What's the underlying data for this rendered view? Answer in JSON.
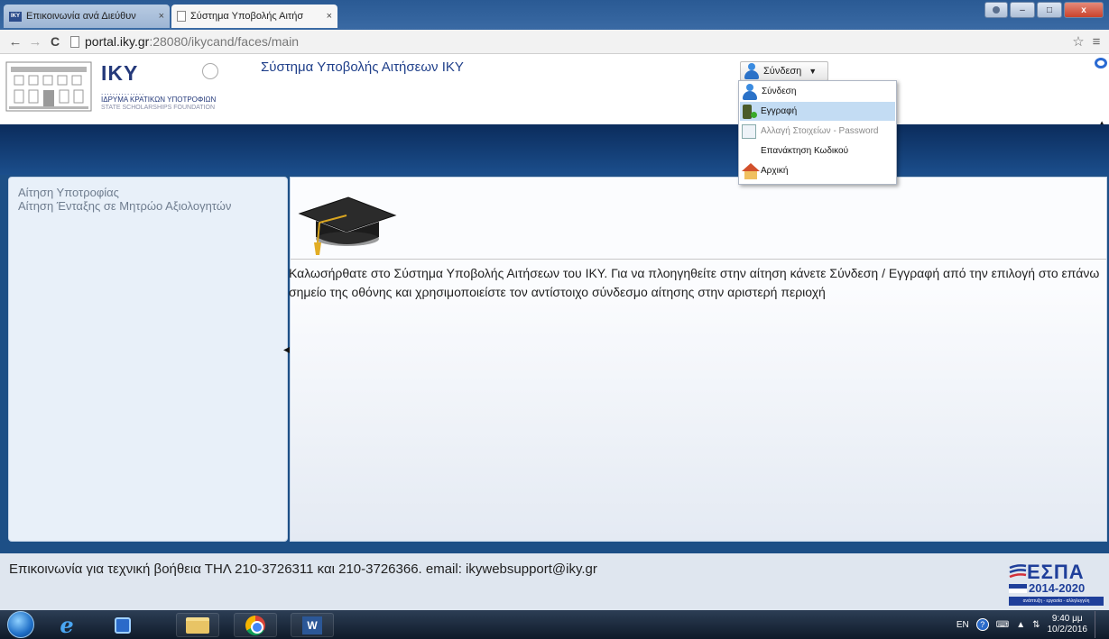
{
  "browser": {
    "tabs": [
      {
        "label": "Επικοινωνία ανά Διεύθυν",
        "favicon": "IKY",
        "close": "×",
        "active": false
      },
      {
        "label": "Σύστημα Υποβολής Αιτήσ",
        "close": "×",
        "active": true
      }
    ],
    "address": {
      "host": "portal.iky.gr",
      "rest": ":28080/ikycand/faces/main"
    },
    "window_controls": {
      "minimize": "–",
      "maximize": "□",
      "close": "x"
    }
  },
  "header": {
    "logo": {
      "abbrev": "IKY",
      "dots": "...............",
      "name_gr": "ΙΔΡΥΜΑ ΚΡΑΤΙΚΩΝ ΥΠΟΤΡΟΦΙΩΝ",
      "name_en": "STATE SCHOLARSHIPS FOUNDATION"
    },
    "title": "Σύστημα Υποβολής Αιτήσεων ΙΚΥ",
    "login_button": "Σύνδεση"
  },
  "login_menu": {
    "items": [
      {
        "label": "Σύνδεση",
        "icon": "user-icon",
        "state": "normal"
      },
      {
        "label": "Εγγραφή",
        "icon": "register-icon",
        "state": "highlighted"
      },
      {
        "label": "Αλλαγή Στοιχείων - Password",
        "icon": "edit-icon",
        "state": "disabled"
      },
      {
        "label": "Επανάκτηση Κωδικού",
        "icon": "",
        "state": "normal"
      },
      {
        "label": "Αρχική",
        "icon": "home-icon",
        "state": "normal"
      }
    ]
  },
  "sidebar": {
    "links": [
      "Αίτηση Υποτροφίας",
      "Αίτηση Ένταξης σε Μητρώο Αξιολογητών"
    ]
  },
  "content": {
    "welcome": "Καλωσήρθατε στο Σύστημα Υποβολής Αιτήσεων του ΙΚΥ. Για να πλοηγηθείτε στην αίτηση κάνετε Σύνδεση / Εγγραφή από την επιλογή στο επάνω σημείο της οθόνης και χρησιμοποιείστε τον αντίστοιχο σύνδεσμο αίτησης στην αριστερή περιοχή"
  },
  "footer": {
    "support_text": "Επικοινωνία για τεχνική βοήθεια ΤΗΛ 210-3726311 και 210-3726366. email: ikywebsupport@iky.gr",
    "espa": {
      "word": "ΕΣΠΑ",
      "years": "2014-2020",
      "slogan": "ανάπτυξη - εργασία - αλληλεγγύη"
    }
  },
  "taskbar": {
    "language": "EN",
    "time": "9:40 μμ",
    "date": "10/2/2016"
  },
  "colors": {
    "portal_blue": "#1d4f86",
    "title_blue": "#1f3f8a",
    "menu_highlight": "#c3dcf3",
    "sidebar_bg": "#e8f0f9"
  }
}
